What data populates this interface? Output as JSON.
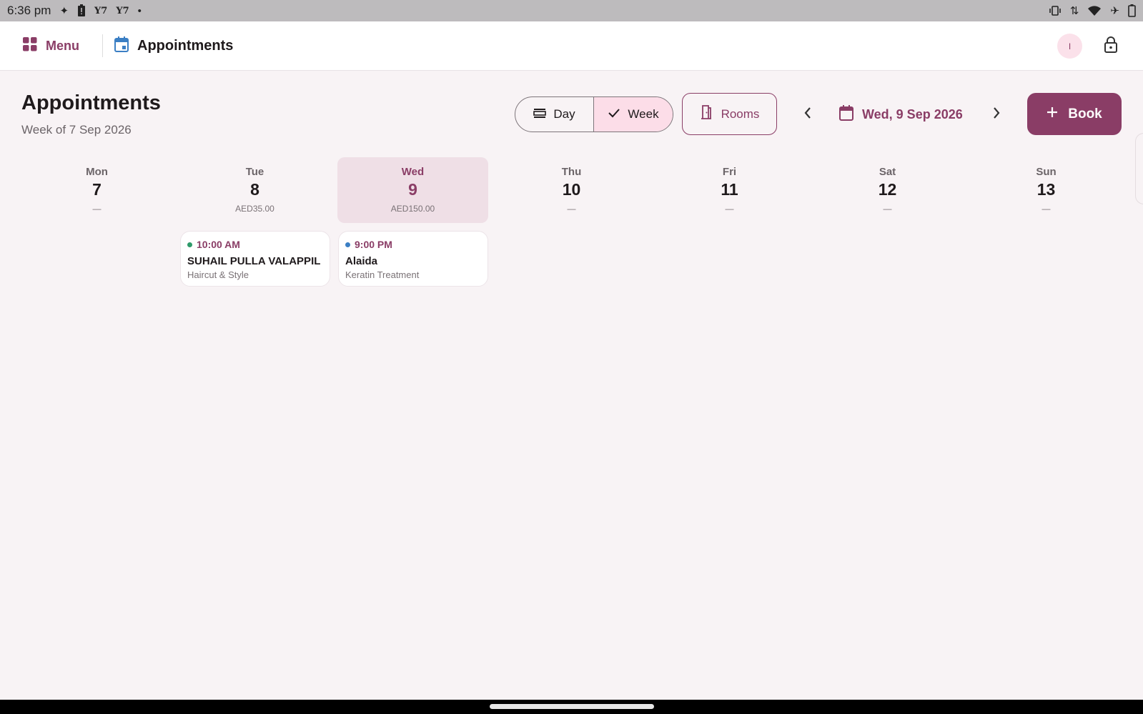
{
  "status_bar": {
    "time": "6:36 pm",
    "y_icon_1": "Y7",
    "y_icon_2": "Y7"
  },
  "app_bar": {
    "menu_label": "Menu",
    "title": "Appointments",
    "avatar_initial": "I"
  },
  "header": {
    "title": "Appointments",
    "subtitle": "Week of 7 Sep 2026",
    "view_toggle": {
      "day": "Day",
      "week": "Week",
      "selected": "Week"
    },
    "rooms_label": "Rooms",
    "date_label": "Wed, 9 Sep 2026",
    "book_label": "Book"
  },
  "colors": {
    "accent": "#8a3d66",
    "selected_day_bg": "#efdfe6",
    "week_toggle_bg": "#fcdde8",
    "dot_green": "#2e9a6a",
    "dot_blue": "#3b7fc4"
  },
  "days": [
    {
      "name": "Mon",
      "num": "7",
      "total": "—"
    },
    {
      "name": "Tue",
      "num": "8",
      "total": "AED35.00"
    },
    {
      "name": "Wed",
      "num": "9",
      "total": "AED150.00"
    },
    {
      "name": "Thu",
      "num": "10",
      "total": "—"
    },
    {
      "name": "Fri",
      "num": "11",
      "total": "—"
    },
    {
      "name": "Sat",
      "num": "12",
      "total": "—"
    },
    {
      "name": "Sun",
      "num": "13",
      "total": "—"
    }
  ],
  "appointments": [
    {
      "time": "10:00 AM",
      "client": "SUHAIL PULLA VALAPPIL",
      "service": "Haircut & Style",
      "status_color": "#2e9a6a"
    },
    {
      "time": "9:00 PM",
      "client": "Alaida",
      "service": "Keratin Treatment",
      "status_color": "#3b7fc4"
    }
  ]
}
